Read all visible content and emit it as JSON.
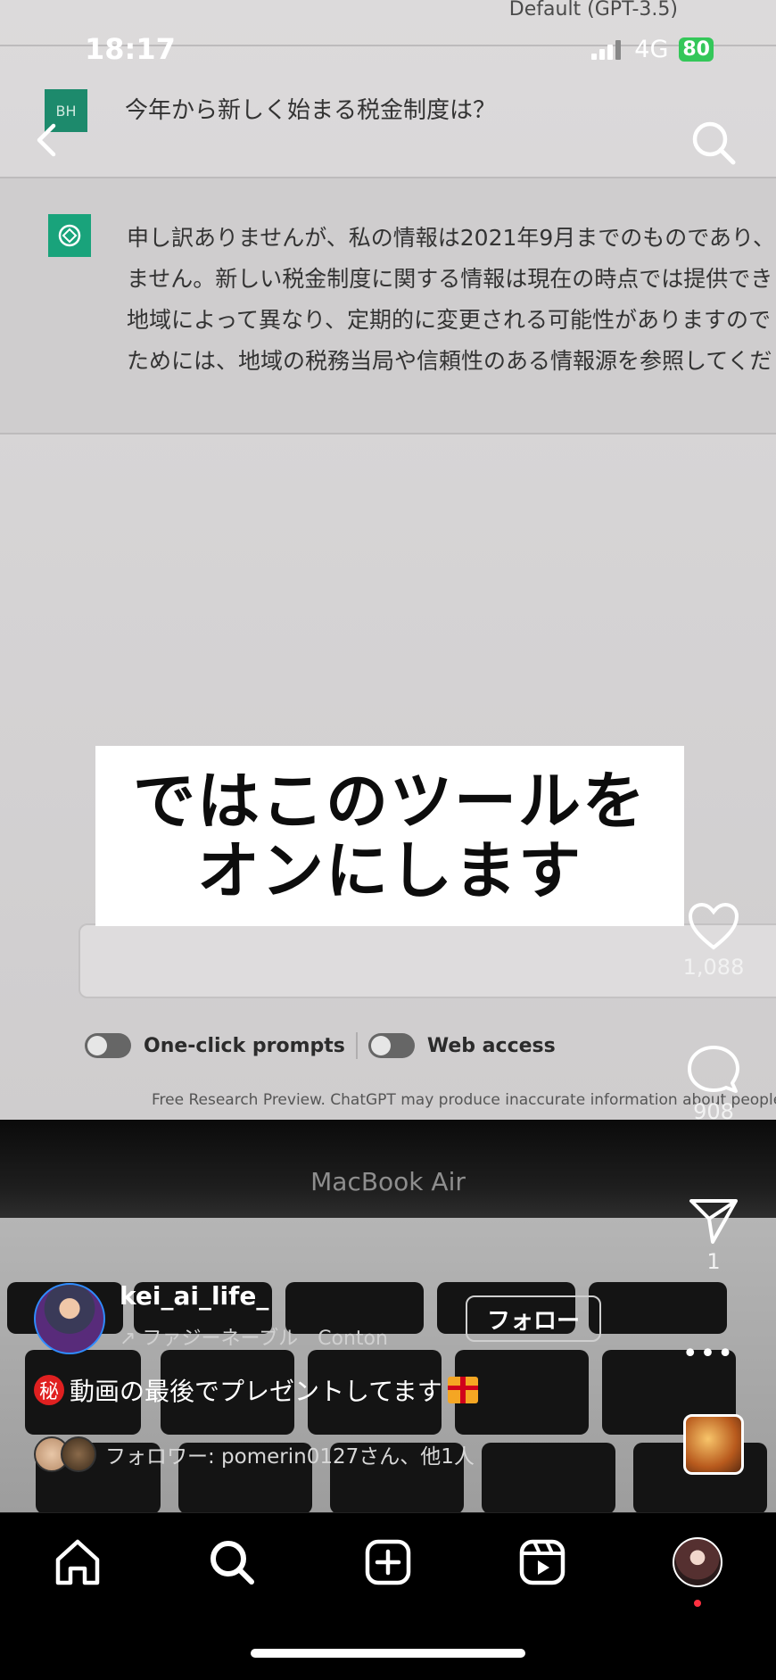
{
  "status_bar": {
    "time": "18:17",
    "network": "4G",
    "battery": "80"
  },
  "video": {
    "model_label": "Default (GPT-3.5)",
    "user_avatar": "BH",
    "question": "今年から新しく始まる税金制度は？",
    "answer_lines": [
      "申し訳ありませんが、私の情報は2021年9月までのものであり、",
      "ません。新しい税金制度に関する情報は現在の時点では提供でき",
      "地域によって異なり、定期的に変更される可能性がありますので",
      "ためには、地域の税務当局や信頼性のある情報源を参照してくだ"
    ],
    "toggle_one_click": "One-click prompts",
    "toggle_web": "Web access",
    "disclaimer": "Free Research Preview. ChatGPT may produce inaccurate information about people, plac",
    "macbook": "MacBook Air",
    "caption_lines": [
      "ではこのツールを",
      "オンにします"
    ]
  },
  "actions": {
    "likes": "1,088",
    "comments": "908",
    "shares": "1"
  },
  "author": {
    "username": "kei_ai_life_",
    "music": "ファジーネーブル　Conton",
    "follow_label": "フォロー"
  },
  "post": {
    "secret_badge": "秘",
    "caption": "動画の最後でプレゼントしてます",
    "followers": "フォロワー: pomerin0127さん、他1人"
  },
  "icons": [
    "back-icon",
    "search-icon",
    "heart-icon",
    "comment-icon",
    "send-icon",
    "more-icon",
    "home-icon",
    "explore-icon",
    "create-icon",
    "reels-icon"
  ],
  "colors": {
    "battery": "#34c759",
    "follow_border": "#cfcfcf",
    "notification_dot": "#ff3040"
  }
}
